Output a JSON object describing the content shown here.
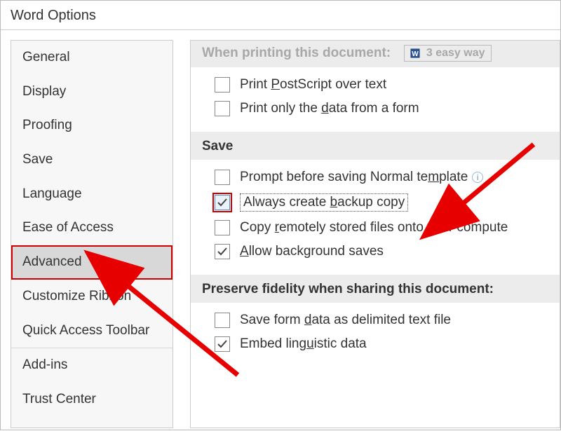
{
  "title": "Word Options",
  "sidebar": {
    "items": [
      {
        "label": "General"
      },
      {
        "label": "Display"
      },
      {
        "label": "Proofing"
      },
      {
        "label": "Save"
      },
      {
        "label": "Language"
      },
      {
        "label": "Ease of Access"
      },
      {
        "label": "Advanced",
        "selected": true
      },
      {
        "label": "Customize Ribbon"
      },
      {
        "label": "Quick Access Toolbar"
      },
      {
        "label": "Add-ins"
      },
      {
        "label": "Trust Center"
      }
    ]
  },
  "content": {
    "printing_header": "When printing this document:",
    "printing_doc": "3 easy way",
    "printing_options": [
      {
        "label": "Print PostScript over text",
        "checked": false
      },
      {
        "label": "Print only the data from a form",
        "checked": false
      }
    ],
    "save_header": "Save",
    "save_options": [
      {
        "label": "Prompt before saving Normal template",
        "checked": false,
        "info": true
      },
      {
        "label": "Always create backup copy",
        "checked": true,
        "highlighted": true
      },
      {
        "label": "Copy remotely stored files onto your compute",
        "checked": false
      },
      {
        "label": "Allow background saves",
        "checked": true
      }
    ],
    "fidelity_header": "Preserve fidelity when sharing this document:",
    "fidelity_options": [
      {
        "label": "Save form data as delimited text file",
        "checked": false
      },
      {
        "label": "Embed linguistic data",
        "checked": true
      }
    ]
  }
}
